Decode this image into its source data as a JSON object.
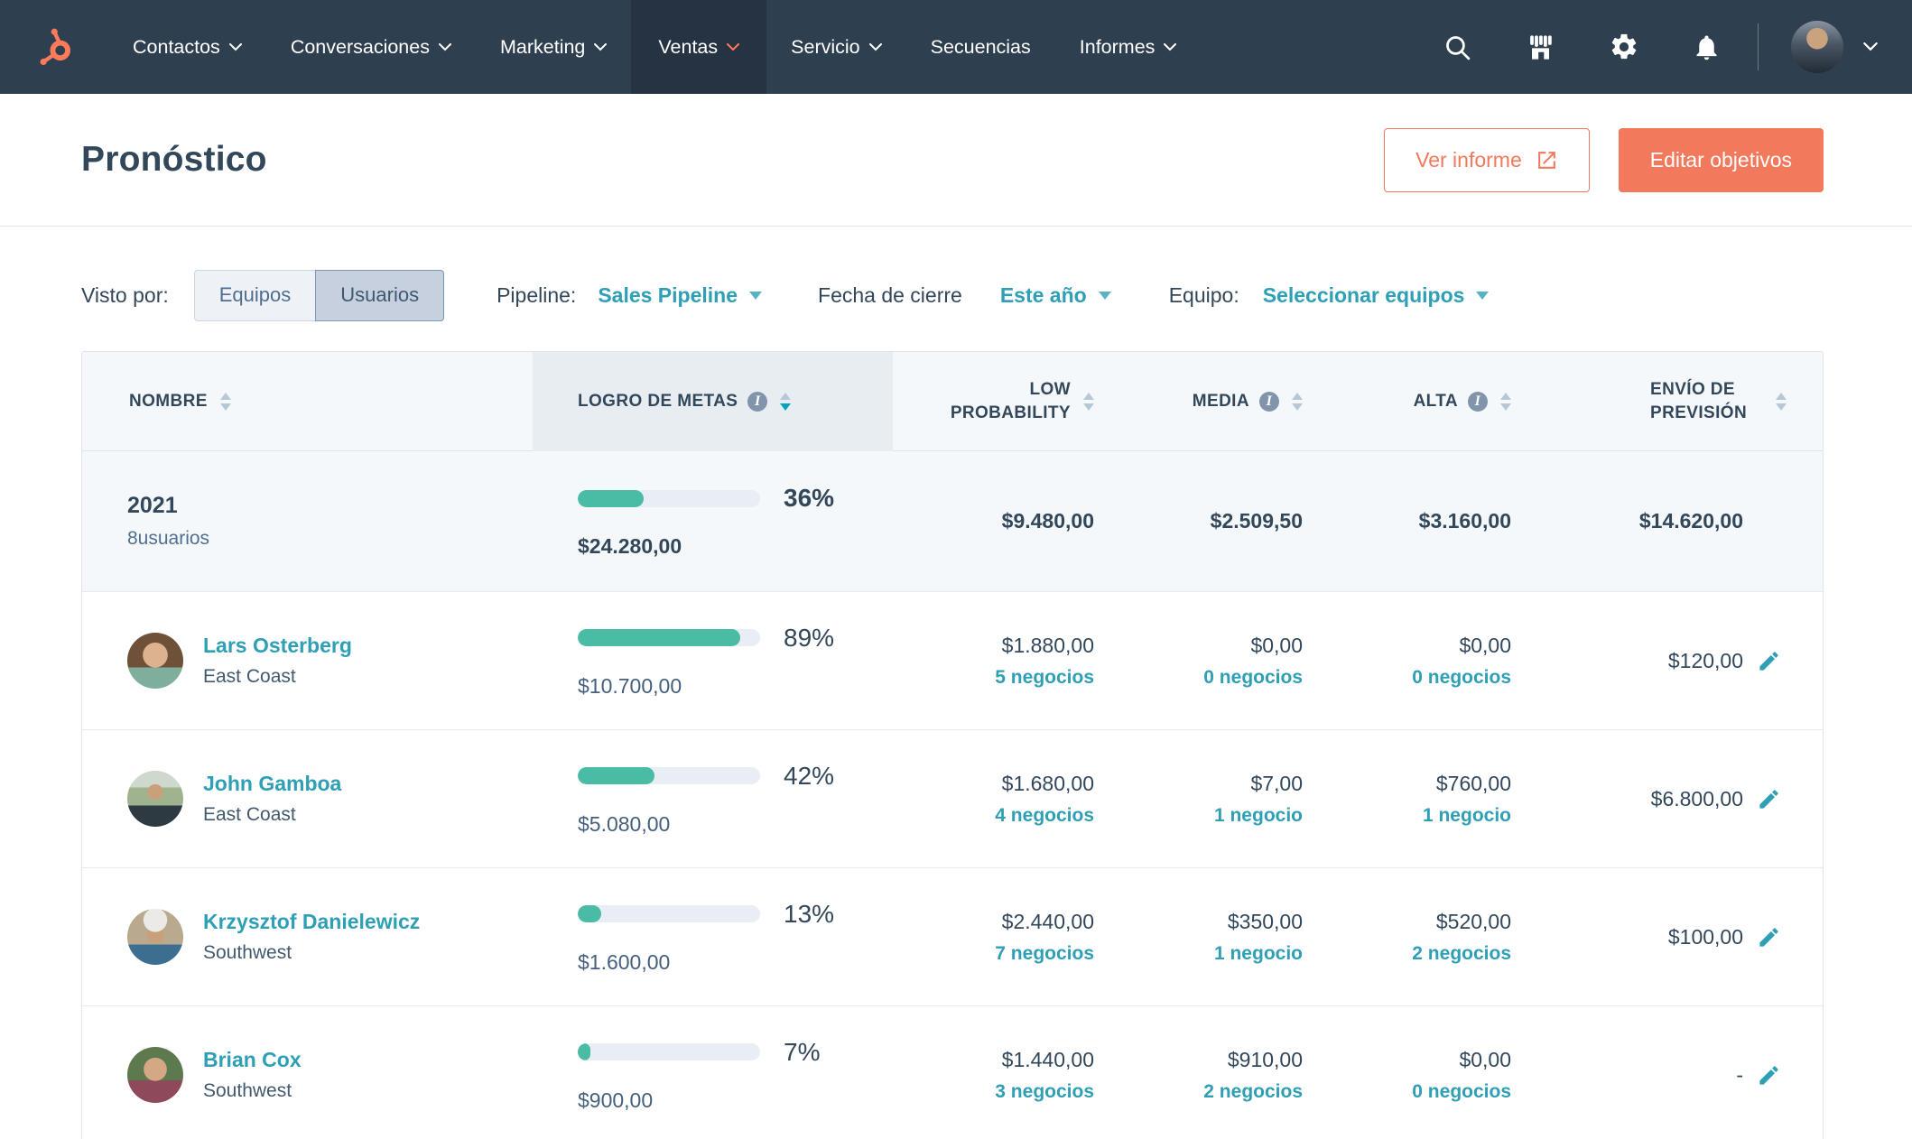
{
  "nav": {
    "items": [
      {
        "label": "Contactos"
      },
      {
        "label": "Conversaciones"
      },
      {
        "label": "Marketing"
      },
      {
        "label": "Ventas"
      },
      {
        "label": "Servicio"
      },
      {
        "label": "Secuencias"
      },
      {
        "label": "Informes"
      }
    ]
  },
  "header": {
    "title": "Pronóstico",
    "view_report_label": "Ver informe",
    "edit_goals_label": "Editar objetivos"
  },
  "filters": {
    "view_by_label": "Visto por:",
    "equipos_label": "Equipos",
    "usuarios_label": "Usuarios",
    "selected_toggle": "Usuarios",
    "pipeline_label": "Pipeline:",
    "pipeline_value": "Sales Pipeline",
    "close_date_label": "Fecha de cierre",
    "close_date_value": "Este año",
    "team_label": "Equipo:",
    "team_value": "Seleccionar equipos"
  },
  "table": {
    "columns": {
      "name": "Nombre",
      "goal": "Logro de metas",
      "low": "Low Probability",
      "media": "Media",
      "alta": "Alta",
      "forecast": "Envío de previsión"
    },
    "sorted_by": "Logro de metas (desc)",
    "summary": {
      "name": "2021",
      "users_count": "8usuarios",
      "percent": 36,
      "percent_label": "36%",
      "goal_total": "$24.280,00",
      "low": "$9.480,00",
      "media": "$2.509,50",
      "alta": "$3.160,00",
      "forecast": "$14.620,00"
    },
    "rows": [
      {
        "name": "Lars Osterberg",
        "team": "East Coast",
        "percent": 89,
        "percent_label": "89%",
        "goal_total": "$10.700,00",
        "low": {
          "amount": "$1.880,00",
          "deals": "5 negocios"
        },
        "media": {
          "amount": "$0,00",
          "deals": "0 negocios"
        },
        "alta": {
          "amount": "$0,00",
          "deals": "0 negocios"
        },
        "forecast": "$120,00"
      },
      {
        "name": "John Gamboa",
        "team": "East Coast",
        "percent": 42,
        "percent_label": "42%",
        "goal_total": "$5.080,00",
        "low": {
          "amount": "$1.680,00",
          "deals": "4 negocios"
        },
        "media": {
          "amount": "$7,00",
          "deals": "1 negocio"
        },
        "alta": {
          "amount": "$760,00",
          "deals": "1 negocio"
        },
        "forecast": "$6.800,00"
      },
      {
        "name": "Krzysztof Danielewicz",
        "team": "Southwest",
        "percent": 13,
        "percent_label": "13%",
        "goal_total": "$1.600,00",
        "low": {
          "amount": "$2.440,00",
          "deals": "7 negocios"
        },
        "media": {
          "amount": "$350,00",
          "deals": "1 negocio"
        },
        "alta": {
          "amount": "$520,00",
          "deals": "2 negocios"
        },
        "forecast": "$100,00"
      },
      {
        "name": "Brian Cox",
        "team": "Southwest",
        "percent": 7,
        "percent_label": "7%",
        "goal_total": "$900,00",
        "low": {
          "amount": "$1.440,00",
          "deals": "3 negocios"
        },
        "media": {
          "amount": "$910,00",
          "deals": "2 negocios"
        },
        "alta": {
          "amount": "$0,00",
          "deals": "0 negocios"
        },
        "forecast": "-"
      }
    ]
  },
  "colors": {
    "navbar": "#2e3f50",
    "navbar_active": "#253342",
    "brand_orange": "#ff7a59",
    "button_orange": "#f2795c",
    "link_teal": "#2e9fb5",
    "progress_green": "#4abba4",
    "text_dark": "#33475b",
    "sort_active": "#00a4bd"
  }
}
